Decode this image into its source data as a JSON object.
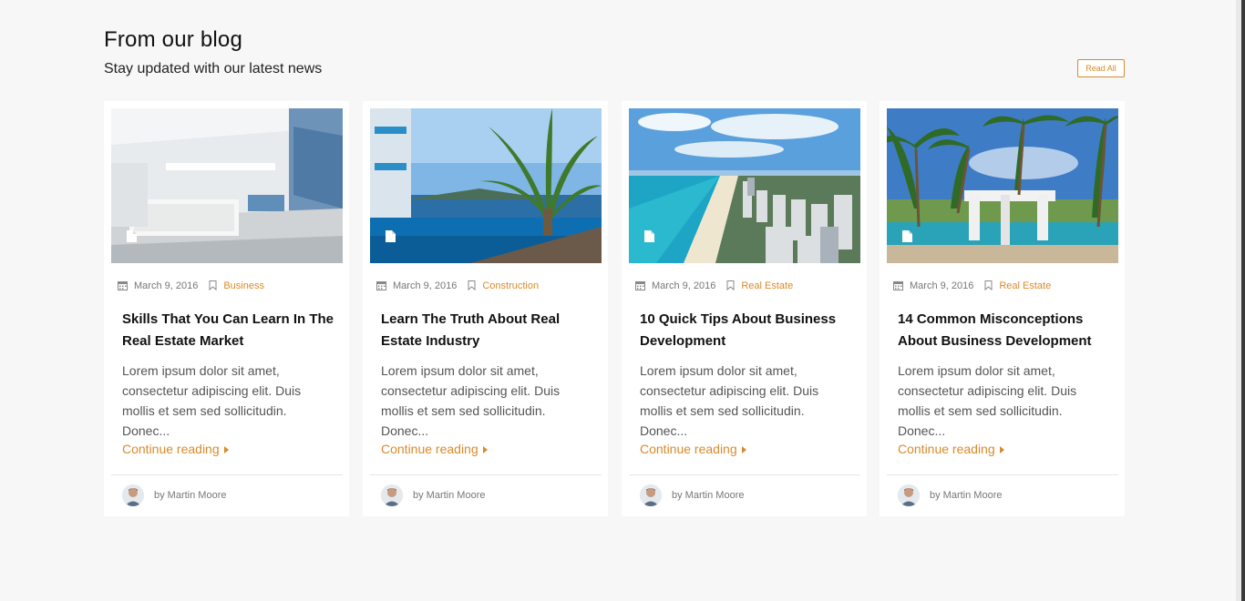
{
  "blog": {
    "heading": "From our blog",
    "subheading": "Stay updated with our latest news",
    "read_all_label": "Read All"
  },
  "colors": {
    "accent": "#d98a2b",
    "background": "#f7f7f7",
    "card": "#ffffff"
  },
  "icons": {
    "date": "calendar-icon",
    "category": "bookmark-icon",
    "post_format": "document-icon",
    "continue": "caret-right-icon"
  },
  "posts": [
    {
      "image": "modern white living room with glass walls",
      "date": "March 9, 2016",
      "category": "Business",
      "title": "Skills That You Can Learn In The Real Estate Market",
      "excerpt": "Lorem ipsum dolor sit amet, consectetur adipiscing elit. Duis mollis et sem sed sollicitudin. Donec...",
      "continue_label": "Continue reading",
      "author": "by Martin Moore"
    },
    {
      "image": "infinity pool with palm tree overlooking sea",
      "date": "March 9, 2016",
      "category": "Construction",
      "title": "Learn The Truth About Real Estate Industry",
      "excerpt": "Lorem ipsum dolor sit amet, consectetur adipiscing elit. Duis mollis et sem sed sollicitudin. Donec...",
      "continue_label": "Continue reading",
      "author": "by Martin Moore"
    },
    {
      "image": "aerial view of beach and city coastline",
      "date": "March 9, 2016",
      "category": "Real Estate",
      "title": "10 Quick Tips About Business Development",
      "excerpt": "Lorem ipsum dolor sit amet, consectetur adipiscing elit. Duis mollis et sem sed sollicitudin. Donec...",
      "continue_label": "Continue reading",
      "author": "by Martin Moore"
    },
    {
      "image": "resort pool with palm trees and pavilion",
      "date": "March 9, 2016",
      "category": "Real Estate",
      "title": "14 Common Misconceptions About Business Development",
      "excerpt": "Lorem ipsum dolor sit amet, consectetur adipiscing elit. Duis mollis et sem sed sollicitudin. Donec...",
      "continue_label": "Continue reading",
      "author": "by Martin Moore"
    }
  ]
}
